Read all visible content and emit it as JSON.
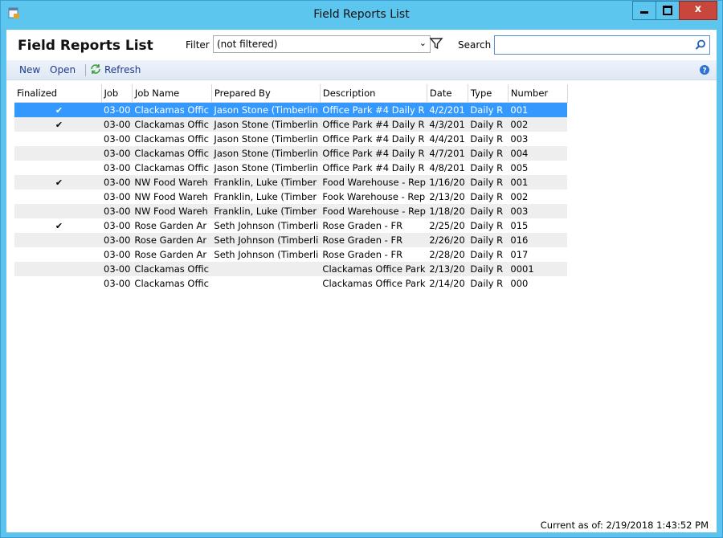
{
  "window": {
    "title": "Field Reports List"
  },
  "header": {
    "title": "Field Reports List",
    "filter_label": "Filter",
    "filter_value": "(not filtered)",
    "search_label": "Search",
    "search_value": ""
  },
  "toolbar": {
    "new_label": "New",
    "open_label": "Open",
    "refresh_label": "Refresh"
  },
  "table": {
    "columns": [
      "Finalized",
      "Job",
      "Job Name",
      "Prepared By",
      "Description",
      "Date",
      "Type",
      "Number"
    ],
    "rows": [
      {
        "finalized": "✔",
        "job": "03-00",
        "job_name": "Clackamas Offic",
        "prepared_by": "Jason Stone (Timberlin",
        "description": "Office Park #4 Daily R",
        "date": "4/2/201",
        "type": "Daily R",
        "number": "001"
      },
      {
        "finalized": "✔",
        "job": "03-00",
        "job_name": "Clackamas Offic",
        "prepared_by": "Jason Stone (Timberlin",
        "description": "Office Park #4 Daily R",
        "date": "4/3/201",
        "type": "Daily R",
        "number": "002"
      },
      {
        "finalized": "",
        "job": "03-00",
        "job_name": "Clackamas Offic",
        "prepared_by": "Jason Stone (Timberlin",
        "description": "Office Park #4 Daily R",
        "date": "4/4/201",
        "type": "Daily R",
        "number": "003"
      },
      {
        "finalized": "",
        "job": "03-00",
        "job_name": "Clackamas Offic",
        "prepared_by": "Jason Stone (Timberlin",
        "description": "Office Park #4 Daily R",
        "date": "4/7/201",
        "type": "Daily R",
        "number": "004"
      },
      {
        "finalized": "",
        "job": "03-00",
        "job_name": "Clackamas Offic",
        "prepared_by": "Jason Stone (Timberlin",
        "description": "Office Park #4 Daily R",
        "date": "4/8/201",
        "type": "Daily R",
        "number": "005"
      },
      {
        "finalized": "✔",
        "job": "03-00",
        "job_name": "NW Food Wareh",
        "prepared_by": "Franklin, Luke (Timber",
        "description": "Food Warehouse - Rep",
        "date": "1/16/20",
        "type": "Daily R",
        "number": "001"
      },
      {
        "finalized": "",
        "job": "03-00",
        "job_name": "NW Food Wareh",
        "prepared_by": "Franklin, Luke (Timber",
        "description": "Fook Warehouse - Rep",
        "date": "2/13/20",
        "type": "Daily R",
        "number": "002"
      },
      {
        "finalized": "",
        "job": "03-00",
        "job_name": "NW Food Wareh",
        "prepared_by": "Franklin, Luke (Timber",
        "description": "Food Warehouse - Rep",
        "date": "1/18/20",
        "type": "Daily R",
        "number": "003"
      },
      {
        "finalized": "✔",
        "job": "03-00",
        "job_name": "Rose Garden Ar",
        "prepared_by": "Seth Johnson (Timberli",
        "description": "Rose Graden - FR",
        "date": "2/25/20",
        "type": "Daily R",
        "number": "015"
      },
      {
        "finalized": "",
        "job": "03-00",
        "job_name": "Rose Garden Ar",
        "prepared_by": "Seth Johnson (Timberli",
        "description": "Rose Graden - FR",
        "date": "2/26/20",
        "type": "Daily R",
        "number": "016"
      },
      {
        "finalized": "",
        "job": "03-00",
        "job_name": "Rose Garden Ar",
        "prepared_by": "Seth Johnson (Timberli",
        "description": "Rose Graden - FR",
        "date": "2/28/20",
        "type": "Daily R",
        "number": "017"
      },
      {
        "finalized": "",
        "job": "03-00",
        "job_name": "Clackamas Offic",
        "prepared_by": "",
        "description": "Clackamas Office Park",
        "date": "2/13/20",
        "type": "Daily R",
        "number": "0001"
      },
      {
        "finalized": "",
        "job": "03-00",
        "job_name": "Clackamas Offic",
        "prepared_by": "",
        "description": "Clackamas Office Park",
        "date": "2/14/20",
        "type": "Daily R",
        "number": "000"
      }
    ],
    "selected_index": 0
  },
  "status": {
    "current_as_of": "Current as of: 2/19/2018 1:43:52 PM"
  },
  "icons": {
    "app": "app-icon",
    "funnel": "funnel-icon",
    "search": "search-icon",
    "refresh": "refresh-icon",
    "help": "help-icon"
  },
  "colors": {
    "titlebar": "#5cc6ef",
    "selection": "#3399ff",
    "close": "#c8463b"
  }
}
